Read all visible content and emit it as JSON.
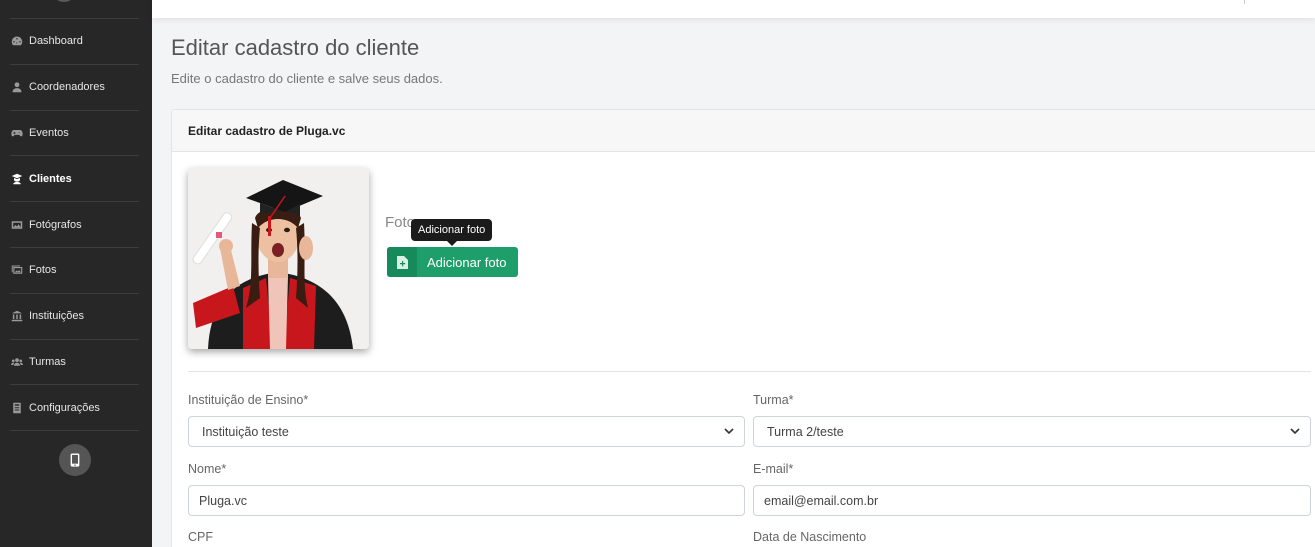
{
  "sidebar": {
    "items": [
      {
        "label": "Dashboard",
        "icon": "dashboard-icon"
      },
      {
        "label": "Coordenadores",
        "icon": "user-icon"
      },
      {
        "label": "Eventos",
        "icon": "gamepad-icon"
      },
      {
        "label": "Clientes",
        "icon": "graduate-icon",
        "active": true
      },
      {
        "label": "Fotógrafos",
        "icon": "photo-icon"
      },
      {
        "label": "Fotos",
        "icon": "images-icon"
      },
      {
        "label": "Instituições",
        "icon": "institution-icon"
      },
      {
        "label": "Turmas",
        "icon": "users-icon"
      },
      {
        "label": "Configurações",
        "icon": "settings-icon"
      }
    ],
    "mobile_icon": "mobile-icon"
  },
  "header": {
    "title": "Editar cadastro do cliente",
    "subtitle": "Edite o cadastro do cliente e salve seus dados."
  },
  "card": {
    "title": "Editar cadastro de Pluga.vc",
    "photo_label": "Foto",
    "tooltip": "Adicionar foto",
    "add_photo_label": "Adicionar foto"
  },
  "form": {
    "instituicao_label": "Instituição de Ensino*",
    "instituicao_value": "Instituição teste",
    "turma_label": "Turma*",
    "turma_value": "Turma 2/teste",
    "nome_label": "Nome*",
    "nome_value": "Pluga.vc",
    "email_label": "E-mail*",
    "email_value": "email@email.com.br",
    "cpf_label": "CPF",
    "nascimento_label": "Data de Nascimento"
  },
  "colors": {
    "sidebar_bg": "#272727",
    "accent_green": "#1e9e6a",
    "page_bg": "#f3f4f6"
  }
}
